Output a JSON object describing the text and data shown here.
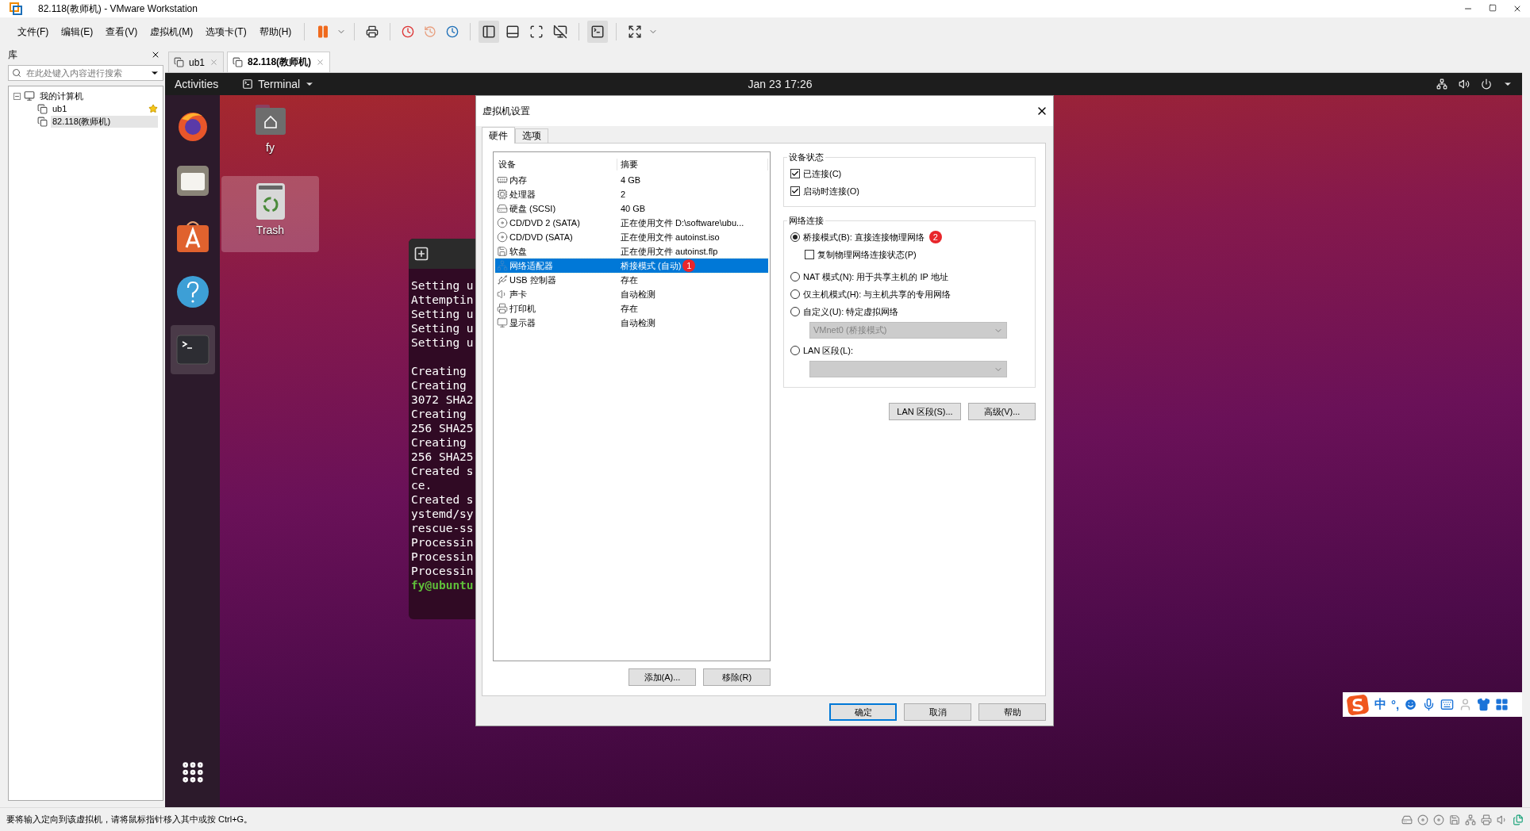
{
  "window": {
    "title": "82.118(教师机) - VMware Workstation"
  },
  "menu": [
    "文件(F)",
    "编辑(E)",
    "查看(V)",
    "虚拟机(M)",
    "选项卡(T)",
    "帮助(H)"
  ],
  "library": {
    "title": "库",
    "search": {
      "placeholder": "在此处键入内容进行搜索"
    },
    "tree": [
      {
        "label": "我的计算机",
        "expanded": true,
        "children": [
          {
            "label": "ub1",
            "favorite": true,
            "selected": false
          },
          {
            "label": "82.118(教师机)",
            "favorite": false,
            "selected": true
          }
        ]
      }
    ]
  },
  "vm_tabs": [
    {
      "label": "ub1",
      "selected": false
    },
    {
      "label": "82.118(教师机)",
      "selected": true
    }
  ],
  "guest": {
    "topbar": {
      "activities": "Activities",
      "app": "Terminal",
      "clock": "Jan 23  17:26"
    },
    "desktop_icons": [
      {
        "label": "fy",
        "kind": "home",
        "selected": false
      },
      {
        "label": "Trash",
        "kind": "trash",
        "selected": true
      }
    ],
    "terminal_blocks": [
      [
        {
          "text": "Setting u",
          "kind": "output"
        },
        {
          "text": "Attemptin",
          "kind": "output"
        },
        {
          "text": "Setting u",
          "kind": "output"
        },
        {
          "text": "Setting u",
          "kind": "output"
        },
        {
          "text": "Setting u",
          "kind": "output"
        }
      ],
      [
        {
          "text": "Creating",
          "kind": "output"
        },
        {
          "text": "Creating",
          "kind": "output"
        },
        {
          "text": "3072 SHA2",
          "kind": "output"
        },
        {
          "text": "Creating",
          "kind": "output"
        },
        {
          "text": "256 SHA25",
          "kind": "output"
        },
        {
          "text": "Creating",
          "kind": "output"
        },
        {
          "text": "256 SHA25",
          "kind": "output"
        },
        {
          "text": "Created s",
          "kind": "output"
        },
        {
          "text": "ce.",
          "kind": "output"
        },
        {
          "text": "Created s",
          "kind": "output"
        },
        {
          "text": "ystemd/sy",
          "kind": "output"
        },
        {
          "text": "rescue-ss",
          "kind": "output"
        },
        {
          "text": "Processin",
          "kind": "output"
        },
        {
          "text": "Processin",
          "kind": "output"
        },
        {
          "text": "Processin",
          "kind": "output"
        },
        {
          "text": "fy@ubuntu",
          "kind": "prompt"
        }
      ]
    ],
    "ime": {
      "mode": "中",
      "punctuation": "°,"
    }
  },
  "dialog": {
    "title": "虚拟机设置",
    "tabs": [
      {
        "label": "硬件",
        "selected": true
      },
      {
        "label": "选项",
        "selected": false
      }
    ],
    "columns": [
      "设备",
      "摘要"
    ],
    "devices": [
      {
        "kind": "memory",
        "name": "内存",
        "summary": "4 GB",
        "selected": false
      },
      {
        "kind": "cpu",
        "name": "处理器",
        "summary": "2",
        "selected": false
      },
      {
        "kind": "disk",
        "name": "硬盘 (SCSI)",
        "summary": "40 GB",
        "selected": false
      },
      {
        "kind": "cdrom",
        "name": "CD/DVD 2 (SATA)",
        "summary": "正在使用文件 D:\\software\\ubu...",
        "selected": false
      },
      {
        "kind": "cdrom",
        "name": "CD/DVD (SATA)",
        "summary": "正在使用文件 autoinst.iso",
        "selected": false
      },
      {
        "kind": "floppy",
        "name": "软盘",
        "summary": "正在使用文件 autoinst.flp",
        "selected": false
      },
      {
        "kind": "network",
        "name": "网络适配器",
        "summary": "桥接模式 (自动)",
        "selected": true,
        "badge": "1"
      },
      {
        "kind": "usb",
        "name": "USB 控制器",
        "summary": "存在",
        "selected": false
      },
      {
        "kind": "sound",
        "name": "声卡",
        "summary": "自动检测",
        "selected": false
      },
      {
        "kind": "printer",
        "name": "打印机",
        "summary": "存在",
        "selected": false
      },
      {
        "kind": "display",
        "name": "显示器",
        "summary": "自动检测",
        "selected": false
      }
    ],
    "list_buttons": [
      "添加(A)...",
      "移除(R)"
    ],
    "device_status": {
      "title": "设备状态",
      "options": [
        {
          "label": "已连接(C)",
          "checked": true
        },
        {
          "label": "启动时连接(O)",
          "checked": true
        }
      ]
    },
    "network": {
      "title": "网络连接",
      "modes": [
        {
          "label": "桥接模式(B): 直接连接物理网络",
          "selected": true,
          "badge": "2",
          "sub_option": {
            "label": "复制物理网络连接状态(P)",
            "checked": false
          }
        },
        {
          "label": "NAT 模式(N): 用于共享主机的 IP 地址",
          "selected": false
        },
        {
          "label": "仅主机模式(H): 与主机共享的专用网络",
          "selected": false
        },
        {
          "label": "自定义(U): 特定虚拟网络",
          "selected": false,
          "dropdown": {
            "value": "VMnet0 (桥接模式)",
            "disabled": true
          }
        },
        {
          "label": "LAN 区段(L):",
          "selected": false,
          "dropdown": {
            "disabled": true
          }
        }
      ]
    },
    "network_buttons": [
      "LAN 区段(S)...",
      "高级(V)..."
    ],
    "footer_buttons": [
      {
        "label": "确定",
        "default": true
      },
      {
        "label": "取消",
        "default": false
      },
      {
        "label": "帮助",
        "default": false
      }
    ]
  },
  "status_bar": {
    "text": "要将输入定向到该虚拟机，请将鼠标指针移入其中或按 Ctrl+G。"
  }
}
